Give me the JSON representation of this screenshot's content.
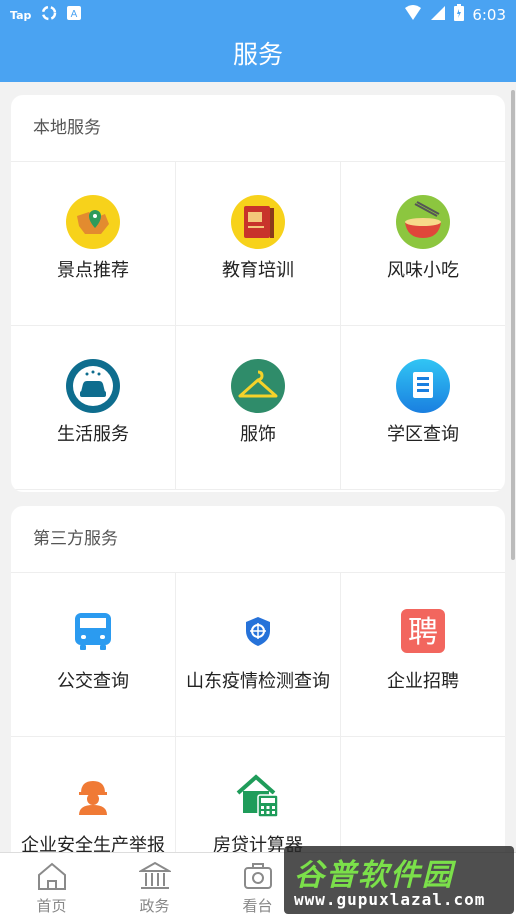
{
  "status_bar": {
    "left_text_1": "Tap",
    "left_icon_2": "sync-icon",
    "left_text_3": "A",
    "time": "6:03",
    "right_icons": [
      "wifi-icon",
      "signal-icon",
      "battery-icon"
    ]
  },
  "app_bar": {
    "title": "服务"
  },
  "local_services": {
    "title": "本地服务",
    "items": [
      {
        "label": "景点推荐",
        "icon": "map-pin-icon"
      },
      {
        "label": "教育培训",
        "icon": "book-icon"
      },
      {
        "label": "风味小吃",
        "icon": "noodle-bowl-icon"
      },
      {
        "label": "生活服务",
        "icon": "car-wash-icon"
      },
      {
        "label": "服饰",
        "icon": "clothes-hanger-icon"
      },
      {
        "label": "学区查询",
        "icon": "school-document-icon"
      }
    ]
  },
  "third_party_services": {
    "title": "第三方服务",
    "items": [
      {
        "label": "公交查询",
        "icon": "bus-icon"
      },
      {
        "label": "山东疫情检测查询",
        "icon": "shield-icon"
      },
      {
        "label": "企业招聘",
        "icon": "recruit-icon"
      },
      {
        "label": "企业安全生产举报",
        "icon": "safety-helmet-icon"
      },
      {
        "label": "房贷计算器",
        "icon": "house-calculator-icon"
      }
    ]
  },
  "tab_bar": {
    "tabs": [
      {
        "label": "首页",
        "icon": "home-icon"
      },
      {
        "label": "政务",
        "icon": "government-building-icon"
      },
      {
        "label": "看台",
        "icon": "camera-icon"
      }
    ]
  },
  "watermark": {
    "brand": "谷普软件园",
    "url": "www.gupuxlazal.com"
  },
  "colors": {
    "primary": "#4aa3f2",
    "background": "#f2f2f2"
  }
}
